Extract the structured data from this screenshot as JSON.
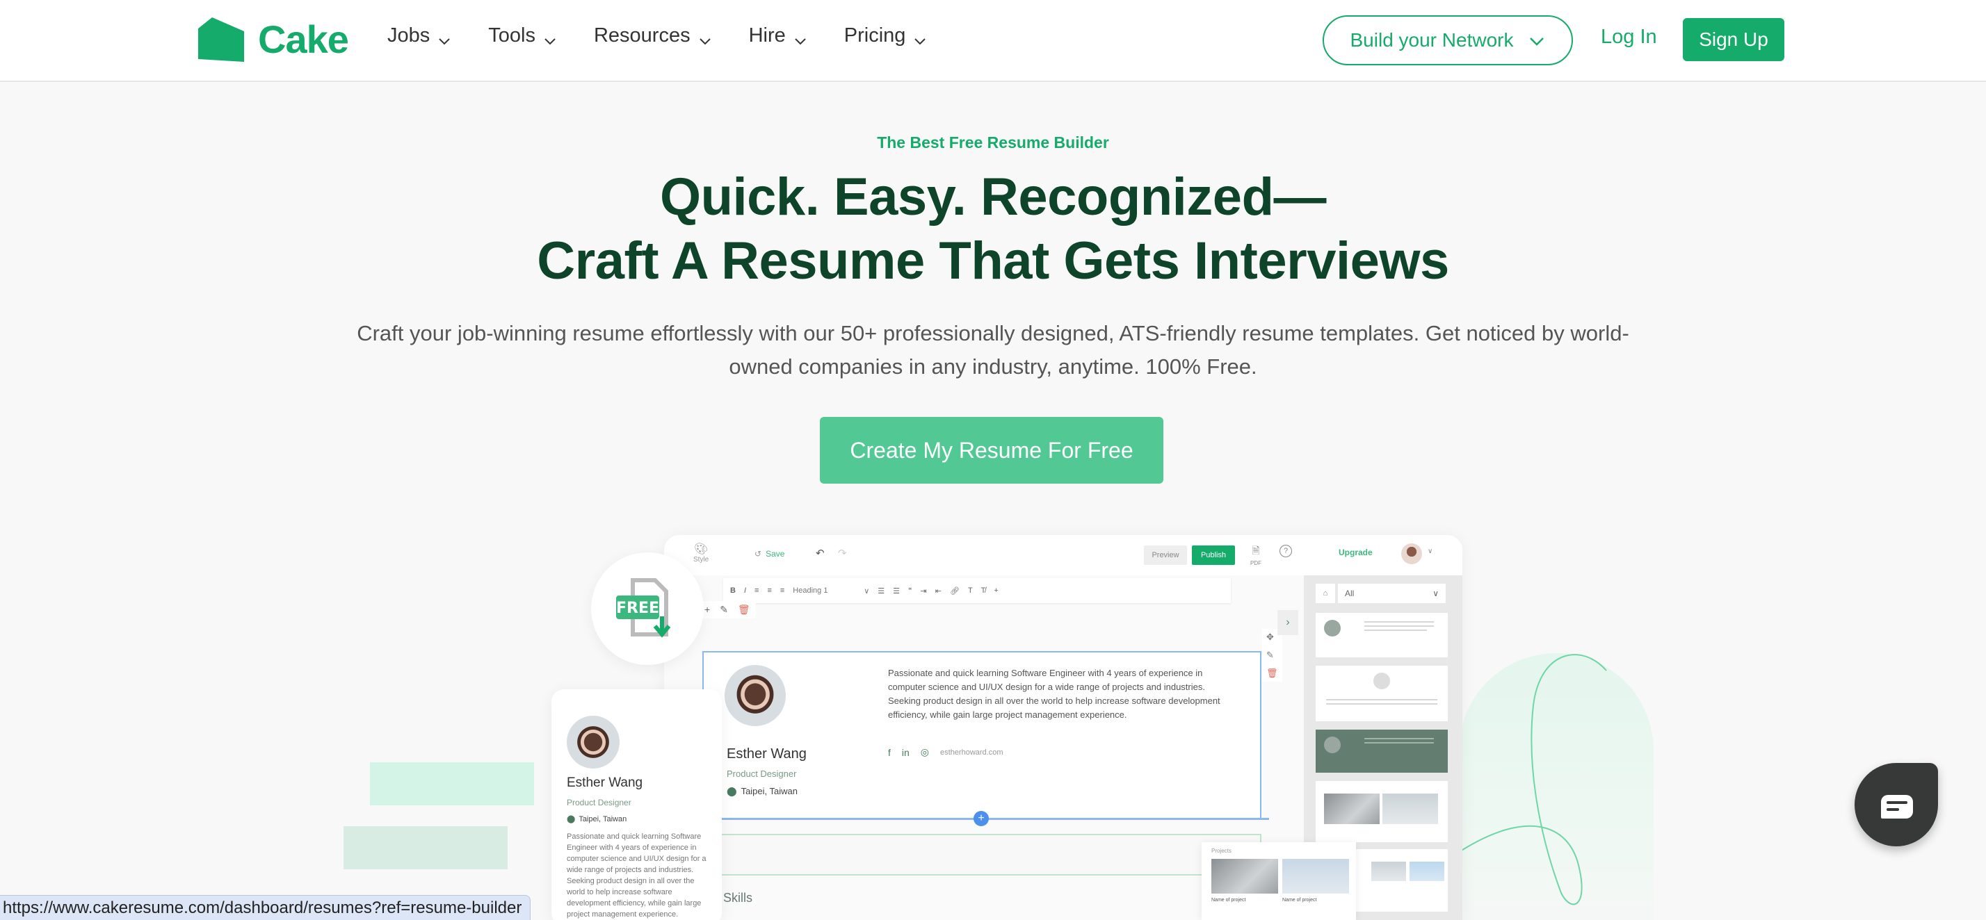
{
  "nav": {
    "brand": "Cake",
    "menu": [
      {
        "label": "Jobs"
      },
      {
        "label": "Tools"
      },
      {
        "label": "Resources"
      },
      {
        "label": "Hire"
      },
      {
        "label": "Pricing"
      }
    ],
    "network_button": "Build your Network",
    "login": "Log In",
    "signup": "Sign Up"
  },
  "hero": {
    "eyebrow": "The Best Free Resume Builder",
    "headline_line1": "Quick. Easy. Recognized—",
    "headline_line2": "Craft A Resume That Gets Interviews",
    "subtitle": "Craft your job-winning resume effortlessly with our 50+ professionally designed, ATS-friendly resume templates. Get noticed by world-owned companies in any industry, anytime. 100% Free.",
    "cta": "Create My Resume For Free"
  },
  "badge": {
    "label": "FREE"
  },
  "editor": {
    "style_label": "Style",
    "save_label": "Save",
    "preview_label": "Preview",
    "publish_label": "Publish",
    "pdf_label": "PDF",
    "help_label": "?",
    "upgrade_label": "Upgrade",
    "toolbar": {
      "bold": "B",
      "italic": "I",
      "heading": "Heading 1",
      "quote": "“",
      "text": "T",
      "clear": "T̸",
      "add": "+"
    },
    "filter_value": "All",
    "resume": {
      "name": "Esther Wang",
      "role": "Product Designer",
      "location": "Taipei, Taiwan",
      "bio": "Passionate and quick learning Software Engineer with 4 years of experience in computer science and UI/UX design for a wide range of projects and industries. Seeking product design in all over the world to help increase software development efficiency, while gain large project management experience.",
      "website": "estherhoward.com"
    },
    "skills_label": "Skills",
    "projects_label": "Projects",
    "project_caption": "Name of project"
  },
  "profile_card": {
    "name": "Esther Wang",
    "role": "Product Designer",
    "location": "Taipei, Taiwan",
    "bio": "Passionate and quick learning Software Engineer with 4 years of experience in computer science and UI/UX design for a wide range of projects and industries. Seeking product design in all over the world to help increase software development efficiency, while gain large project management experience."
  },
  "status_bar": {
    "url": "https://www.cakeresume.com/dashboard/resumes?ref=resume-builder"
  },
  "colors": {
    "brand_green": "#15ab6a",
    "cta_green": "#52c995",
    "headline_green": "#0e4429",
    "chat_dark": "#363938"
  }
}
